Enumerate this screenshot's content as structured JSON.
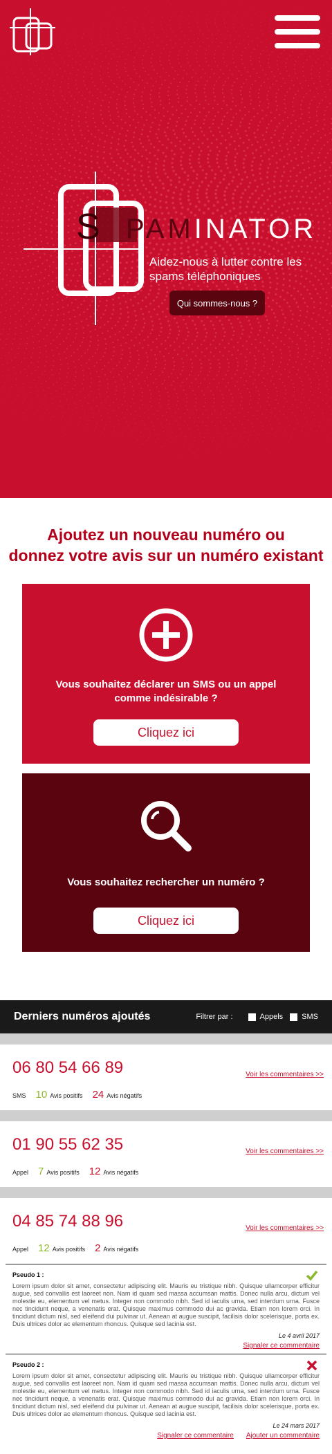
{
  "hero": {
    "brand_s": "S",
    "brand_pam": "PAM",
    "brand_rest": "INATOR",
    "tagline": "Aidez-nous à lutter contre les spams téléphoniques",
    "about_button": "Qui sommes-nous ?"
  },
  "add_section": {
    "title_line1": "Ajoutez un nouveau numéro ou",
    "title_line2": "donnez votre avis sur un numéro existant",
    "declare_card": {
      "icon": "plus-circle-icon",
      "text": "Vous souhaitez déclarer un SMS ou un appel comme indésirable ?",
      "button": "Cliquez ici"
    },
    "search_card": {
      "icon": "magnifier-icon",
      "text": "Vous souhaitez rechercher un numéro ?",
      "button": "Cliquez ici"
    }
  },
  "list": {
    "title": "Derniers numéros ajoutés",
    "filter_label": "Filtrer par :",
    "filters": [
      "Appels",
      "SMS"
    ],
    "items": [
      {
        "number": "06 80 54 66 89",
        "type": "SMS",
        "positive": "10",
        "positive_label": "Avis positifs",
        "negative": "24",
        "negative_label": "Avis négatifs",
        "link": "Voir les commentaires >>"
      },
      {
        "number": "01 90 55 62 35",
        "type": "Appel",
        "positive": "7",
        "positive_label": "Avis positifs",
        "negative": "12",
        "negative_label": "Avis négatifs",
        "link": "Voir les commentaires >>"
      },
      {
        "number": "04 85 74 88 96",
        "type": "Appel",
        "positive": "12",
        "positive_label": "Avis positifs",
        "negative": "2",
        "negative_label": "Avis négatifs",
        "link": "Voir les commentaires >>"
      }
    ]
  },
  "comments": [
    {
      "author": "Pseudo 1 :",
      "status_icon": "checkmark-icon",
      "status_color": "#8cb82b",
      "body": "Lorem ipsum dolor sit amet, consectetur adipiscing elit. Mauris eu tristique nibh. Quisque ullamcorper efficitur augue, sed convallis est laoreet non. Nam id quam sed massa accumsan mattis. Donec nulla arcu, dictum vel molestie eu, elementum vel metus. Integer non commodo nibh. Sed id iaculis urna, sed interdum urna. Fusce nec tincidunt neque, a venenatis erat. Quisque maximus commodo dui ac gravida. Etiam non lorem orci. In tincidunt dictum nisl, sed eleifend dui pulvinar ut. Aenean at augue suscipit, facilisis dolor scelerisque, porta ex. Duis ultrices dolor ac elementum rhoncus. Quisque sed lacinia est.",
      "date": "Le 4 avril 2017",
      "actions": [
        "Signaler ce commentaire"
      ]
    },
    {
      "author": "Pseudo 2 :",
      "status_icon": "cross-icon",
      "status_color": "#c8102e",
      "body": "Lorem ipsum dolor sit amet, consectetur adipiscing elit. Mauris eu tristique nibh. Quisque ullamcorper efficitur augue, sed convallis est laoreet non. Nam id quam sed massa accumsan mattis. Donec nulla arcu, dictum vel molestie eu, elementum vel metus. Integer non commodo nibh. Sed id iaculis urna, sed interdum urna. Fusce nec tincidunt neque, a venenatis erat. Quisque maximus commodo dui ac gravida. Etiam non lorem orci. In tincidunt dictum nisl, sed eleifend dui pulvinar ut. Aenean at augue suscipit, facilisis dolor scelerisque, porta ex. Duis ultrices dolor ac elementum rhoncus. Quisque sed lacinia est.",
      "date": "Le 24 mars 2017",
      "actions": [
        "Signaler ce commentaire",
        "Ajouter un commentaire"
      ]
    }
  ]
}
